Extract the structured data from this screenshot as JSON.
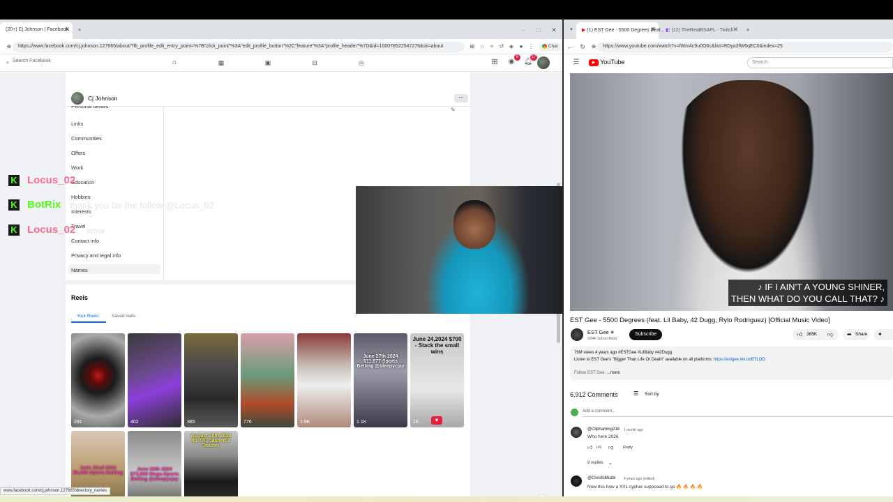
{
  "left_browser": {
    "tabs": [
      {
        "label": "(20+) Cj Johnson | Facebook"
      }
    ],
    "url": "https://www.facebook.com/cj.johnson.127665/about/?fb_profile_edit_entry_point=%7B\"click_point\"%3A\"edit_profile_button\"%2C\"feature\"%3A\"profile_header\"%7D&id=100078522547276&sk=about",
    "chat_label": "Chat",
    "status_url": "www.facebook.com/cj.johnson.127665/directory_names"
  },
  "facebook": {
    "search_placeholder": "Search Facebook",
    "nav_icons": [
      "home-icon",
      "video-icon",
      "marketplace-icon",
      "store-icon",
      "gaming-icon"
    ],
    "right_icons": [
      "menu-grid-icon",
      "messenger-icon",
      "bell-icon",
      "avatar"
    ],
    "badges": {
      "messenger": "6",
      "notifications": "17"
    },
    "profile_name": "Cj Johnson",
    "about_sidebar": [
      "Personal details",
      "Links",
      "Communities",
      "Offers",
      "Work",
      "Education",
      "Hobbies",
      "Interests",
      "Travel",
      "Contact info",
      "Privacy and legal info",
      "Names"
    ],
    "reels_title": "Reels",
    "reels_tabs": [
      "Your Reels",
      "Saved reels"
    ],
    "reels": [
      {
        "views": "291",
        "caption": ""
      },
      {
        "views": "402",
        "caption": ""
      },
      {
        "views": "385",
        "caption": ""
      },
      {
        "views": "776",
        "caption": ""
      },
      {
        "views": "1.9K",
        "caption": ""
      },
      {
        "views": "1.1K",
        "caption": "June 27th 2024 $11,977 Sports Betting @sleepycjay"
      },
      {
        "views": "1K",
        "caption": "June 24,2024 $700 - Stack the small wins"
      },
      {
        "views": "",
        "caption": "June 22nd 2024 $8,465 Sports Betting"
      },
      {
        "views": "",
        "caption": "June 20th 2024 $73,888 Mega-Sports Betting @sleepycjay"
      },
      {
        "views": "",
        "caption": "August 20th 2024 $1,770 Cashed 2 Teamer"
      }
    ]
  },
  "chat_overlay": [
    {
      "user": "Locus_02",
      "message": "yo",
      "color": "#ff6b8a"
    },
    {
      "user": "BotRix",
      "message": "thank you for the follow @Locus_02",
      "color": "#53fc18"
    },
    {
      "user": "Locus_02",
      "message": "wow",
      "color": "#ff6b8a"
    }
  ],
  "right_browser": {
    "tabs": [
      {
        "label": "(1) EST Gee - 5500 Degrees (feat..."
      },
      {
        "label": "(12) TheRealBSAPL - Twitch"
      }
    ],
    "url": "https://www.youtube.com/watch?v=fWm4c9u0O6c&list=RDya3fW6qEC0&index=25"
  },
  "youtube": {
    "logo_text": "YouTube",
    "search_placeholder": "Search",
    "subtitle_line1": "♪ IF I AIN'T A YOUNG SHINER,",
    "subtitle_line2": "THEN WHAT DO YOU CALL THAT? ♪",
    "video_title": "EST Gee - 5500 Degrees (feat. Lil Baby, 42 Dugg, Rylo Rodriguez) [Official Music Video]",
    "channel": "EST Gee",
    "subscribers": "934K subscribers",
    "subscribe_label": "Subscribe",
    "likes": "385K",
    "share_label": "Share",
    "description_meta": "76M views  4 years ago  #ESTGee #LilBaby #42Dugg",
    "description_text": "Listen to EST Gee's \"Bigger Than Life Or Death\" available on all platforms:",
    "description_link": "https://estgee.lnk.to/BTLOD",
    "description_more_prefix": "Follow EST Gee:",
    "description_more": "...more",
    "comments_count": "6,912 Comments",
    "sort_label": "Sort by",
    "add_comment_placeholder": "Add a comment...",
    "comments": [
      {
        "user": "@Cliphaming216",
        "time": "1 month ago",
        "text": "Who here 2026",
        "likes": "146",
        "reply_label": "Reply",
        "replies": "8 replies"
      },
      {
        "user": "@CrestlsMuzik",
        "time": "4 years ago (edited)",
        "text": "Now this how a XXL cypher supposed to go 🔥 🔥 🔥 🔥"
      }
    ]
  },
  "colors": {
    "fb_blue": "#0866ff",
    "yt_red": "#ff0000",
    "kick_green": "#53fc18"
  }
}
